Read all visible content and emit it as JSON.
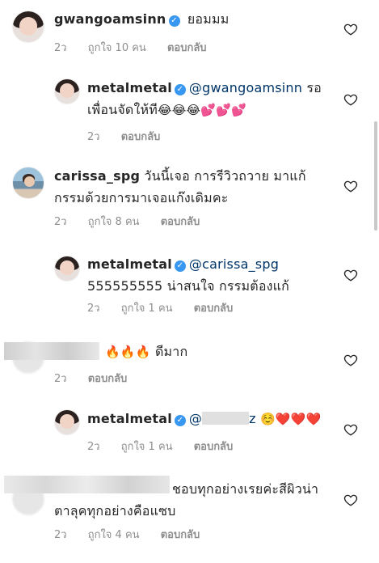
{
  "comments": [
    {
      "user": "gwangoamsinn",
      "verified": true,
      "text": "ยอมมม",
      "time": "2ว",
      "likes": "ถูกใจ 10 คน",
      "reply": "ตอบกลับ"
    },
    {
      "user": "metalmetal",
      "verified": true,
      "mention": "@gwangoamsinn",
      "text_a": " รอ",
      "text_b": "เพื่อนจัดให้ที",
      "emojis": "😂😂😂💕💕💕",
      "time": "2ว",
      "reply": "ตอบกลับ"
    },
    {
      "user": "carissa_spg",
      "text_a": " วันนี้เจอ การรีวิวถวาย มาแก้",
      "text_b": "กรรมด้วยการมาเจอแก๊งเดิมคะ",
      "time": "2ว",
      "likes": "ถูกใจ 8 คน",
      "reply": "ตอบกลับ"
    },
    {
      "user": "metalmetal",
      "verified": true,
      "mention": "@carissa_spg",
      "text_b": "555555555 น่าสนใจ กรรมต้องแก้",
      "time": "2ว",
      "likes": "ถูกใจ 1 คน",
      "reply": "ตอบกลับ"
    },
    {
      "emojis": "🔥🔥🔥",
      "text": "ดีมาก",
      "time": "2ว",
      "reply": "ตอบกลับ"
    },
    {
      "user": "metalmetal",
      "verified": true,
      "mention_tail": "z",
      "emojis": "☺️❤️❤️❤️",
      "time": "2ว",
      "likes": "ถูกใจ 1 คน",
      "reply": "ตอบกลับ"
    },
    {
      "text_a": "ชอบทุกอย่างเรยค่ะสีผิวน่า",
      "text_b": "ตาลุคทุกอย่างคือแซบ",
      "time": "2ว",
      "likes": "ถูกใจ 4 คน",
      "reply": "ตอบกลับ"
    }
  ],
  "icons": {
    "verified": "verified-badge-icon",
    "like": "heart-outline-icon"
  },
  "colors": {
    "mention": "#003569",
    "verified": "#3897f0",
    "meta": "#8e8e8e"
  }
}
